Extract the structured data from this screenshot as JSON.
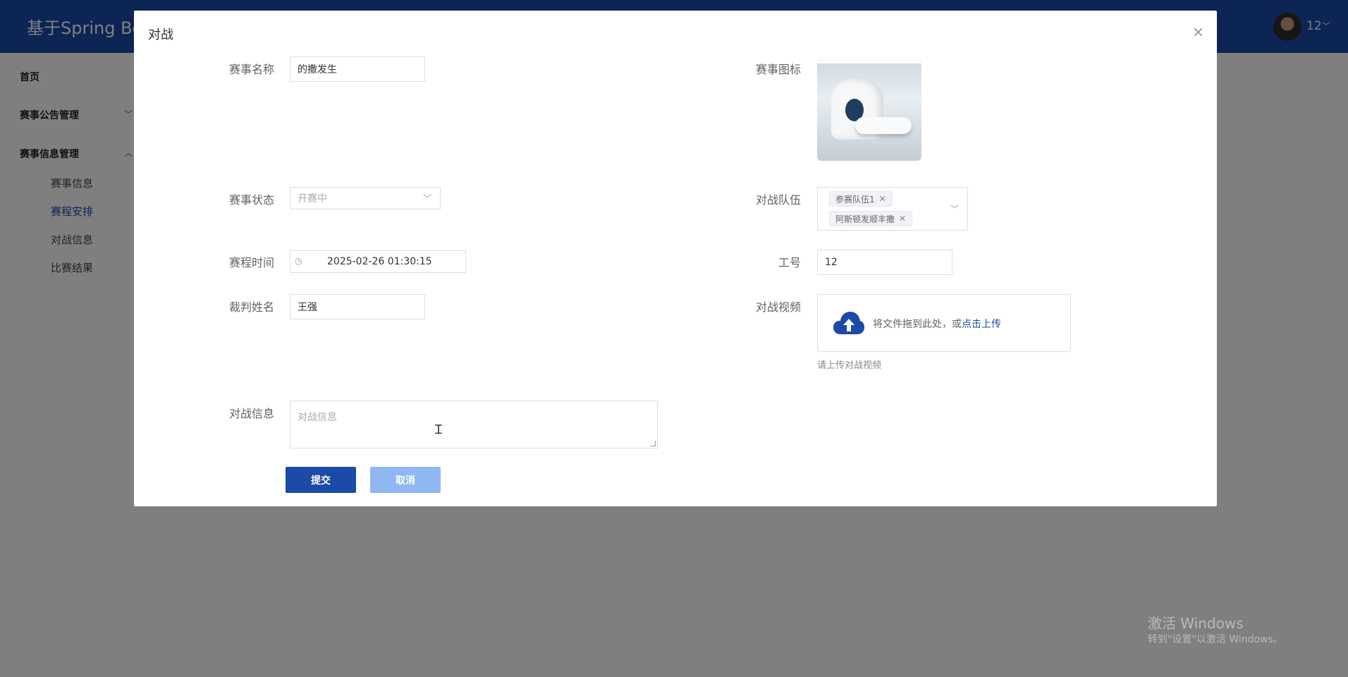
{
  "app": {
    "title": "基于Spring Boo"
  },
  "user": {
    "name": "12",
    "caret": "﹀"
  },
  "sidebar": {
    "items": [
      {
        "label": "首页"
      },
      {
        "label": "赛事公告管理",
        "caret": "﹀"
      },
      {
        "label": "赛事信息管理",
        "caret": "︿"
      }
    ],
    "subitems": [
      {
        "label": "赛事信息"
      },
      {
        "label": "赛程安排",
        "active": true
      },
      {
        "label": "对战信息"
      },
      {
        "label": "比赛结果"
      }
    ]
  },
  "dialog": {
    "title": "对战",
    "close": "×",
    "form": {
      "event_name": {
        "label": "赛事名称",
        "value": "的撒发生"
      },
      "event_icon": {
        "label": "赛事图标"
      },
      "event_status": {
        "label": "赛事状态",
        "value": "开赛中"
      },
      "teams": {
        "label": "对战队伍",
        "tags": [
          "参赛队伍1",
          "阿斯顿发顺丰撒"
        ]
      },
      "schedule_time": {
        "label": "赛程时间",
        "value": "2025-02-26 01:30:15"
      },
      "job_no": {
        "label": "工号",
        "value": "12"
      },
      "referee": {
        "label": "裁判姓名",
        "value": "王强"
      },
      "video": {
        "label": "对战视频",
        "drop_text": "将文件拖到此处，或",
        "upload_link": "点击上传",
        "tip": "请上传对战视频"
      },
      "battle_info": {
        "label": "对战信息",
        "placeholder": "对战信息"
      }
    },
    "buttons": {
      "submit": "提交",
      "cancel": "取消"
    }
  },
  "watermark": {
    "line1": "激活 Windows",
    "line2": "转到\"设置\"以激活 Windows。"
  },
  "colors": {
    "primary": "#1b4aa8",
    "cancel": "#8fb8f2",
    "overlay": "rgba(0,0,0,0.5)"
  }
}
